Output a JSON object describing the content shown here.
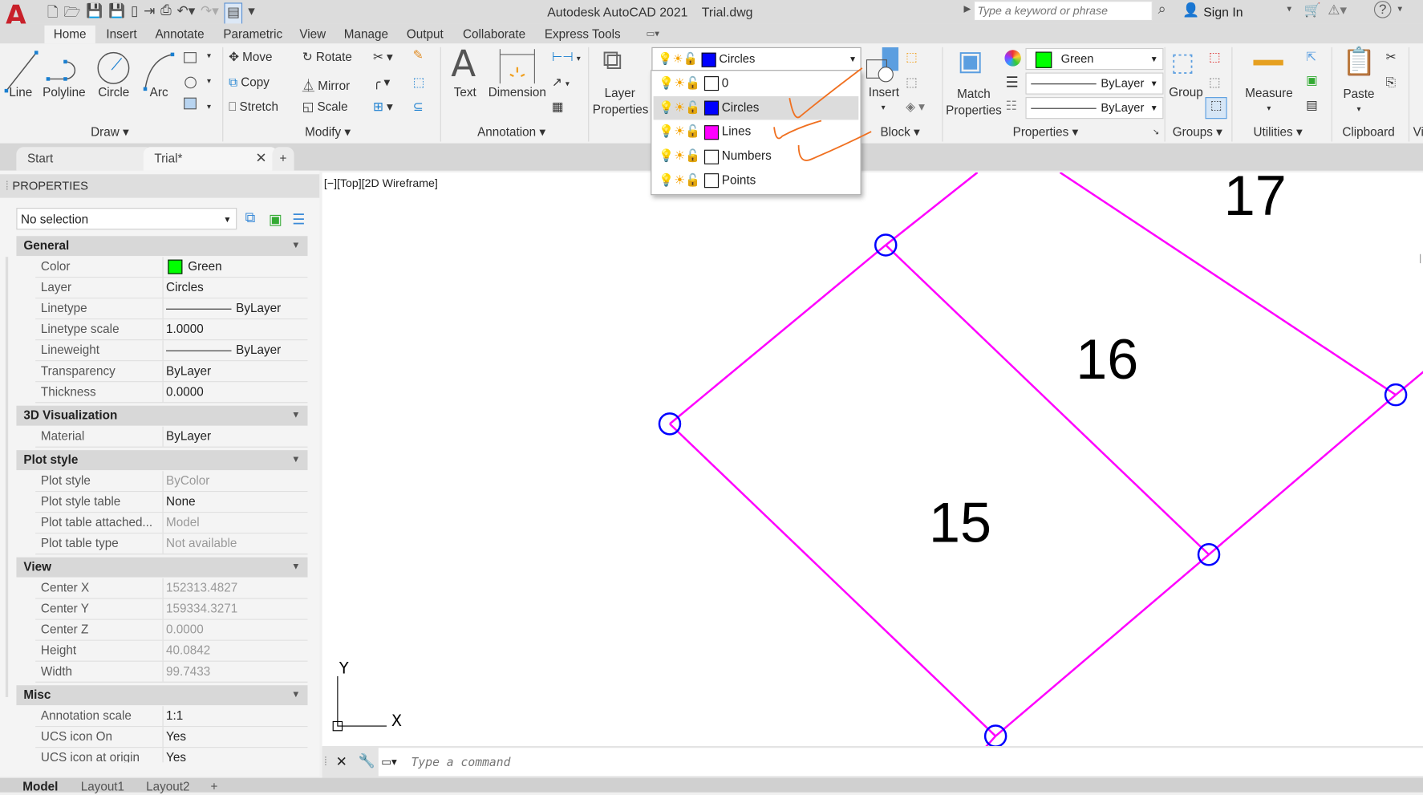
{
  "title": {
    "app": "Autodesk AutoCAD 2021",
    "file": "Trial.dwg",
    "search_placeholder": "Type a keyword or phrase",
    "sign_in": "Sign In"
  },
  "ribbon_tabs": [
    "Home",
    "Insert",
    "Annotate",
    "Parametric",
    "View",
    "Manage",
    "Output",
    "Collaborate",
    "Express Tools"
  ],
  "draw": {
    "label": "Draw",
    "tools": [
      "Line",
      "Polyline",
      "Circle",
      "Arc"
    ]
  },
  "modify": {
    "label": "Modify",
    "tools": [
      "Move",
      "Rotate",
      "Copy",
      "Mirror",
      "Stretch",
      "Scale"
    ]
  },
  "annotation": {
    "label": "Annotation",
    "tools": [
      "Text",
      "Dimension"
    ]
  },
  "layers": {
    "button": "Layer Properties",
    "current": "Circles",
    "list": [
      {
        "name": "0",
        "color": "#ffffff"
      },
      {
        "name": "Circles",
        "color": "#0000ff"
      },
      {
        "name": "Lines",
        "color": "#ff00ff"
      },
      {
        "name": "Numbers",
        "color": "#ffffff"
      },
      {
        "name": "Points",
        "color": "#ffffff"
      }
    ]
  },
  "block": {
    "label": "Block",
    "insert": "Insert"
  },
  "properties_panel": {
    "label": "Properties",
    "match": "Match Properties",
    "color": "Green",
    "color_hex": "#00ff00",
    "linetype": "ByLayer",
    "lineweight": "ByLayer"
  },
  "groups": {
    "label": "Groups",
    "group": "Group"
  },
  "utilities": {
    "label": "Utilities",
    "measure": "Measure"
  },
  "clipboard": {
    "label": "Clipboard",
    "paste": "Paste",
    "more": "Vi"
  },
  "doc_tabs": [
    "Start",
    "Trial*"
  ],
  "palette": {
    "title": "PROPERTIES",
    "selection": "No selection",
    "sections": [
      {
        "name": "General",
        "rows": [
          {
            "k": "Color",
            "v": "Green",
            "swatch": "#00ff00"
          },
          {
            "k": "Layer",
            "v": "Circles"
          },
          {
            "k": "Linetype",
            "v": "ByLayer",
            "line": true
          },
          {
            "k": "Linetype scale",
            "v": "1.0000"
          },
          {
            "k": "Lineweight",
            "v": "ByLayer",
            "line": true
          },
          {
            "k": "Transparency",
            "v": "ByLayer"
          },
          {
            "k": "Thickness",
            "v": "0.0000"
          }
        ]
      },
      {
        "name": "3D Visualization",
        "rows": [
          {
            "k": "Material",
            "v": "ByLayer"
          }
        ]
      },
      {
        "name": "Plot style",
        "rows": [
          {
            "k": "Plot style",
            "v": "ByColor",
            "dim": true
          },
          {
            "k": "Plot style table",
            "v": "None"
          },
          {
            "k": "Plot table attached...",
            "v": "Model",
            "dim": true
          },
          {
            "k": "Plot table type",
            "v": "Not available",
            "dim": true
          }
        ]
      },
      {
        "name": "View",
        "rows": [
          {
            "k": "Center X",
            "v": "152313.4827",
            "dim": true
          },
          {
            "k": "Center Y",
            "v": "159334.3271",
            "dim": true
          },
          {
            "k": "Center Z",
            "v": "0.0000",
            "dim": true
          },
          {
            "k": "Height",
            "v": "40.0842",
            "dim": true
          },
          {
            "k": "Width",
            "v": "99.7433",
            "dim": true
          }
        ]
      },
      {
        "name": "Misc",
        "rows": [
          {
            "k": "Annotation scale",
            "v": "1:1"
          },
          {
            "k": "UCS icon On",
            "v": "Yes"
          },
          {
            "k": "UCS icon at origin",
            "v": "Yes"
          }
        ]
      }
    ]
  },
  "viewport": {
    "label": "[−][Top][2D Wireframe]",
    "numbers": [
      "15",
      "16",
      "17"
    ],
    "ucs_x": "X",
    "ucs_y": "Y",
    "line_color": "#ff00ff",
    "circle_color": "#0000ff"
  },
  "command": {
    "placeholder": "Type a command"
  },
  "layout_tabs": [
    "Model",
    "Layout1",
    "Layout2"
  ]
}
